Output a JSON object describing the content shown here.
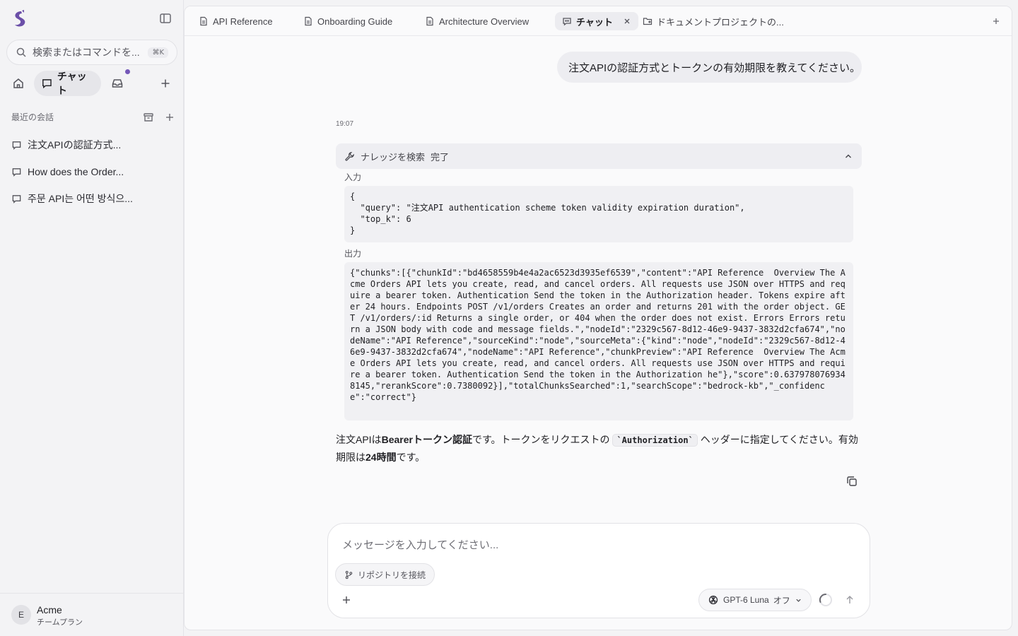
{
  "sidebar": {
    "search": {
      "placeholder": "検索またはコマンドを...",
      "shortcut": "⌘K"
    },
    "nav": {
      "chat_label": "チャット"
    },
    "recent": {
      "title": "最近の会話",
      "items": [
        {
          "label": "注文APIの認証方式..."
        },
        {
          "label": "How does the Order..."
        },
        {
          "label": "주문 API는 어떤 방식으..."
        }
      ]
    },
    "footer": {
      "avatar_letter": "E",
      "team_name": "Acme",
      "plan": "チームプラン"
    }
  },
  "tabs": [
    {
      "label": "API Reference",
      "icon": "document-icon"
    },
    {
      "label": "Onboarding Guide",
      "icon": "document-icon"
    },
    {
      "label": "Architecture Overview",
      "icon": "document-icon"
    },
    {
      "label": "チャット",
      "icon": "chat-bot-icon",
      "active": true
    },
    {
      "label": "ドキュメントプロジェクトの...",
      "icon": "folder-link-icon"
    }
  ],
  "chat": {
    "user_message": "注文APIの認証方式とトークンの有効期限を教えてください。",
    "timestamp": "19:07",
    "tool": {
      "name": "ナレッジを検索",
      "status": "完了",
      "input_label": "入力",
      "input": "{\n  \"query\": \"注文API authentication scheme token validity expiration duration\",\n  \"top_k\": 6\n}",
      "output_label": "出力",
      "output": "{\"chunks\":[{\"chunkId\":\"bd4658559b4e4a2ac6523d3935ef6539\",\"content\":\"API Reference  Overview The Acme Orders API lets you create, read, and cancel orders. All requests use JSON over HTTPS and require a bearer token. Authentication Send the token in the Authorization header. Tokens expire after 24 hours. Endpoints POST /v1/orders Creates an order and returns 201 with the order object. GET /v1/orders/:id Returns a single order, or 404 when the order does not exist. Errors Errors return a JSON body with code and message fields.\",\"nodeId\":\"2329c567-8d12-46e9-9437-3832d2cfa674\",\"nodeName\":\"API Reference\",\"sourceKind\":\"node\",\"sourceMeta\":{\"kind\":\"node\",\"nodeId\":\"2329c567-8d12-46e9-9437-3832d2cfa674\",\"nodeName\":\"API Reference\",\"chunkPreview\":\"API Reference  Overview The Acme Orders API lets you create, read, and cancel orders. All requests use JSON over HTTPS and require a bearer token. Authentication Send the token in the Authorization he\"},\"score\":0.6379780769348145,\"rerankScore\":0.7380092}],\"totalChunksSearched\":1,\"searchScope\":\"bedrock-kb\",\"_confidence\":\"correct\"}"
    },
    "answer": {
      "p1": "注文APIは",
      "b1": "Bearerトークン認証",
      "p2": "です。トークンをリクエストの ",
      "code": "`Authorization`",
      "p3": " ヘッダーに指定してください。有効期限は",
      "b2": "24時間",
      "p4": "です。"
    }
  },
  "composer": {
    "placeholder": "メッセージを入力してください...",
    "repo_button": "リポジトリを接続",
    "model_label": "GPT-6 Luna",
    "model_mode": "オフ"
  },
  "colors": {
    "accent": "#7457b8",
    "logo": "#6b4fa8"
  }
}
